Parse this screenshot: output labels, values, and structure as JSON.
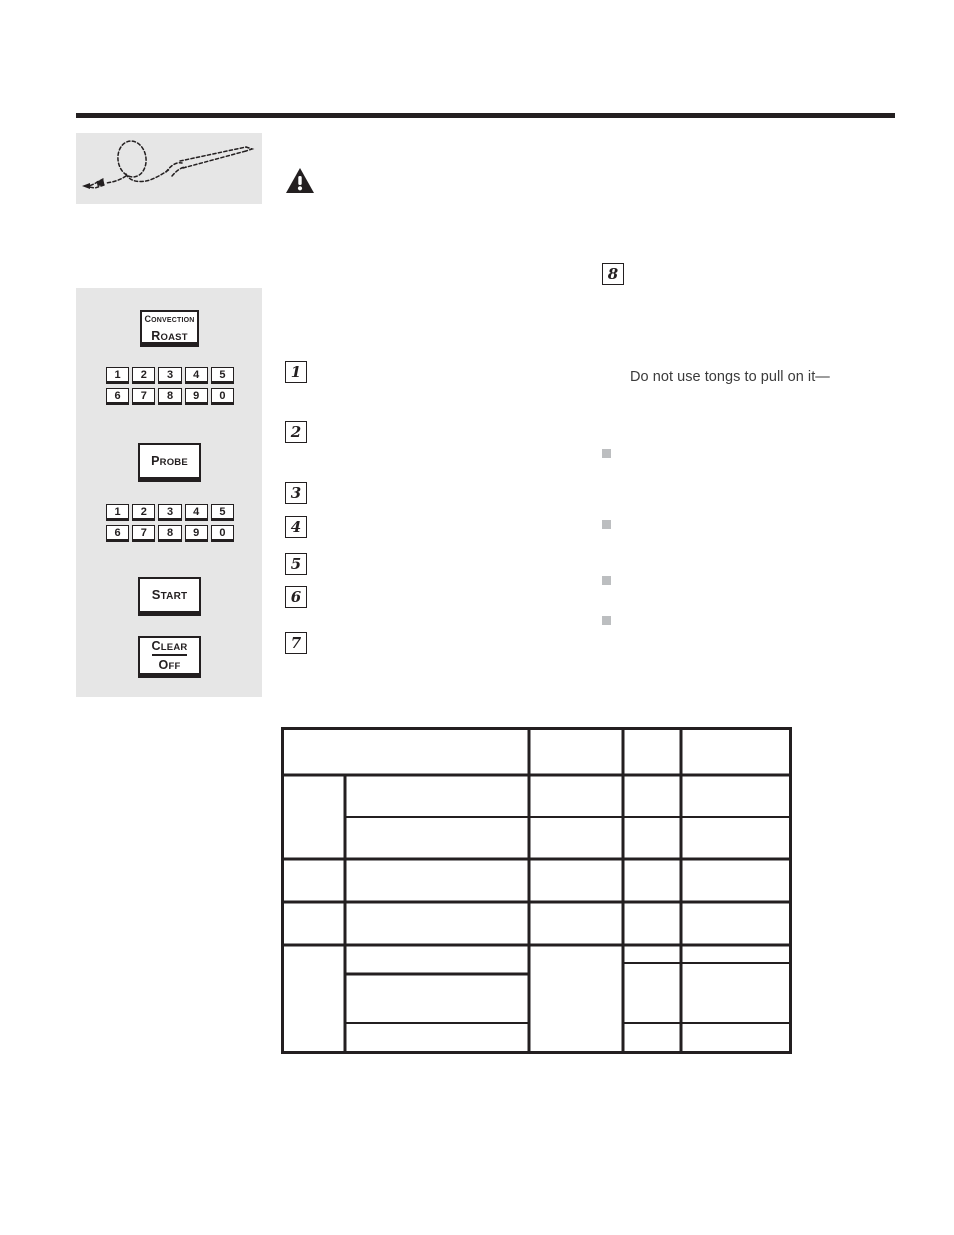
{
  "page": {
    "background_color": "#ffffff",
    "rule_color": "#231f20",
    "panel_background": "#e6e6e6",
    "bullet_color": "#bcbec0",
    "text_color": "#3b3b3b"
  },
  "figure": {
    "caption": "",
    "icon": "meat-probe-illustration"
  },
  "warning": {
    "icon": "warning-triangle-icon",
    "label": ""
  },
  "control_panel": {
    "keys": [
      {
        "name": "convection-roast",
        "line1": "Convection",
        "line2": "Roast"
      },
      {
        "name": "probe",
        "line1": "Probe",
        "line2": ""
      },
      {
        "name": "start",
        "line1": "Start",
        "line2": ""
      },
      {
        "name": "clear-off",
        "line1": "Clear",
        "line2": "Off"
      }
    ],
    "numpad_rows": [
      [
        "1",
        "2",
        "3",
        "4",
        "5"
      ],
      [
        "6",
        "7",
        "8",
        "9",
        "0"
      ]
    ]
  },
  "steps": {
    "left_column": [
      "1",
      "2",
      "3",
      "4",
      "5",
      "6",
      "7"
    ],
    "right_column": [
      "8"
    ]
  },
  "notes": {
    "tongs_warning": "Do not use tongs to pull on it—"
  },
  "bullets": {
    "marker": "square-bullet",
    "count": 4,
    "items": [
      "",
      "",
      "",
      ""
    ]
  },
  "chart_data": {
    "type": "table",
    "title": "",
    "columns": [
      "",
      "",
      "",
      "",
      ""
    ],
    "rows": [
      {
        "cells": [
          "",
          "",
          "",
          ""
        ]
      },
      {
        "cells": [
          "",
          "",
          "",
          "",
          ""
        ]
      },
      {
        "cells": [
          "",
          "",
          "",
          ""
        ]
      },
      {
        "cells": [
          "",
          "",
          "",
          ""
        ]
      },
      {
        "cells": [
          "",
          "",
          "",
          ""
        ]
      },
      {
        "cells": [
          "",
          "",
          "",
          ""
        ]
      },
      {
        "cells": [
          "",
          "",
          "",
          ""
        ]
      },
      {
        "cells": [
          "",
          "",
          "",
          ""
        ]
      }
    ]
  }
}
